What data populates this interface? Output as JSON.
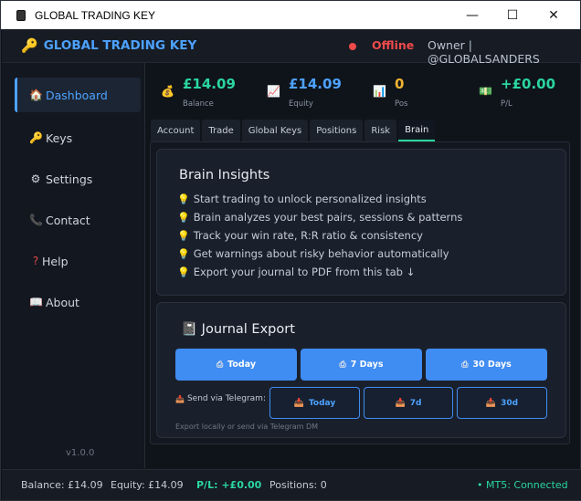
{
  "window": {
    "title": "GLOBAL TRADING KEY",
    "controls": {
      "minimize": "—",
      "maximize": "☐",
      "close": "✕"
    }
  },
  "header": {
    "app_icon": "key-icon",
    "app_title": "GLOBAL TRADING KEY",
    "status": "Offline",
    "status_color": "#f04a4a",
    "owner": "Owner | @GLOBALSANDERS"
  },
  "sidebar": {
    "items": [
      {
        "icon": "house-icon",
        "glyph": "🏠",
        "label": "Dashboard",
        "active": true
      },
      {
        "icon": "key-icon",
        "glyph": "🔑",
        "label": "Keys",
        "active": false
      },
      {
        "icon": "gear-icon",
        "glyph": "⚙",
        "label": "Settings",
        "active": false
      },
      {
        "icon": "phone-icon",
        "glyph": "📞",
        "label": "Contact",
        "active": false
      },
      {
        "icon": "question-icon",
        "glyph": "❓",
        "label": "Help",
        "active": false
      },
      {
        "icon": "book-icon",
        "glyph": "📖",
        "label": "About",
        "active": false
      }
    ],
    "version": "v1.0.0"
  },
  "stats": [
    {
      "icon": "money-bag-icon",
      "glyph": "💰",
      "value": "£14.09",
      "label": "Balance",
      "color": "#2bd6a0"
    },
    {
      "icon": "chart-up-icon",
      "glyph": "📈",
      "value": "£14.09",
      "label": "Equity",
      "color": "#4da2ff"
    },
    {
      "icon": "bar-chart-icon",
      "glyph": "📊",
      "value": "0",
      "label": "Pos",
      "color": "#f2b531"
    },
    {
      "icon": "cash-icon",
      "glyph": "💵",
      "value": "+£0.00",
      "label": "P/L",
      "color": "#2bd6a0"
    }
  ],
  "tabs": [
    "Account",
    "Trade",
    "Global Keys",
    "Positions",
    "Risk",
    "Brain"
  ],
  "active_tab": "Brain",
  "brain": {
    "title": "Brain Insights",
    "insights": [
      "Start trading to unlock personalized insights",
      "Brain analyzes your best pairs, sessions & patterns",
      "Track your win rate, R:R ratio & consistency",
      "Get warnings about risky behavior automatically",
      "Export your journal to PDF from this tab ↓"
    ]
  },
  "journal": {
    "title": "Journal Export",
    "export_buttons": [
      "Today",
      "7 Days",
      "30 Days"
    ],
    "telegram_label": "Send via Telegram:",
    "telegram_buttons": [
      "Today",
      "7d",
      "30d"
    ],
    "hint": "Export locally or send via Telegram DM"
  },
  "footer": {
    "balance": "Balance: £14.09",
    "equity": "Equity: £14.09",
    "pl": "P/L: +£0.00",
    "positions": "Positions: 0",
    "connection": "• MT5: Connected"
  },
  "colors": {
    "accent": "#4da2ff",
    "positive": "#2bd6a0",
    "warning": "#f2b531",
    "danger": "#f04a4a"
  }
}
